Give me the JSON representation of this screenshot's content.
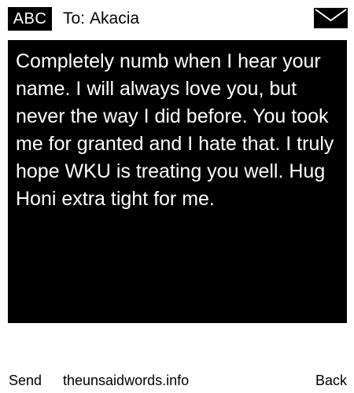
{
  "header": {
    "mode_label": "ABC",
    "to_label": "To:",
    "recipient": "Akacia",
    "envelope_icon": "envelope-icon"
  },
  "message": {
    "text": "Completely numb when I hear your name. I will always love you, but never the way I did before. You took me for granted and I hate that. I truly hope WKU is treating you well. Hug Honi extra tight for me."
  },
  "footer": {
    "send_label": "Send",
    "site_label": "theunsaidwords.info",
    "back_label": "Back"
  },
  "colors": {
    "background": "#ffffff",
    "message_background": "#000000",
    "message_text": "#ffffff"
  }
}
